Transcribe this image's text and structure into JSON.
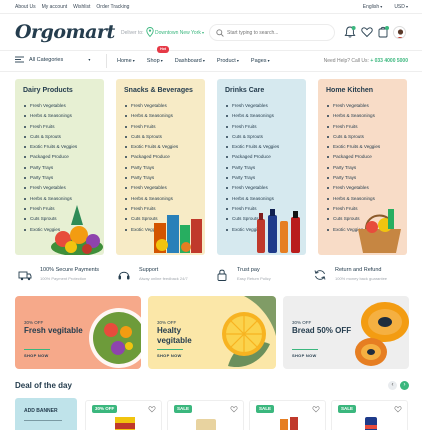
{
  "topbar": {
    "links": [
      "About Us",
      "My account",
      "Wishlist",
      "Order Tracking"
    ],
    "language": "English",
    "currency": "USD"
  },
  "header": {
    "logo": "Orgomart",
    "deliver_label": "Deliver to:",
    "location": "Downtown New York",
    "search_placeholder": "Start typing to search..."
  },
  "nav": {
    "all_categories": "All Categories",
    "menu": [
      "Home",
      "Shop",
      "Dashboard",
      "Product",
      "Pages"
    ],
    "hot_badge": "Hot",
    "help_label": "Need Help? Call Us:",
    "help_phone": "+ 033 4000 5000"
  },
  "categories": [
    {
      "title": "Dairy Products",
      "bg": "#e7f0d3",
      "items": [
        "Fresh Vegetables",
        "Herbs & Seasonings",
        "Fresh Fruits",
        "Cuts & Sprouts",
        "Exotic Fruits & Veggies",
        "Packaged Produce",
        "Party Trays",
        "Party Trays",
        "Fresh Vegetables",
        "Herbs & Seasonings",
        "Fresh Fruits",
        "Cuts Sprouts",
        "Exotic Veggies"
      ]
    },
    {
      "title": "Snacks & Beverages",
      "bg": "#f7ebc6",
      "items": [
        "Fresh Vegetables",
        "Herbs & Seasonings",
        "Fresh Fruits",
        "Cuts & Sprouts",
        "Exotic Fruits & Veggies",
        "Packaged Produce",
        "Party Trays",
        "Party Trays",
        "Fresh Vegetables",
        "Herbs & Seasonings",
        "Fresh Fruits",
        "Cuts Sprouts",
        "Exotic Veggies"
      ]
    },
    {
      "title": "Drinks Care",
      "bg": "#d6e9ef",
      "items": [
        "Fresh Vegetables",
        "Herbs & Seasonings",
        "Fresh Fruits",
        "Cuts & Sprouts",
        "Exotic Fruits & Veggies",
        "Packaged Produce",
        "Party Trays",
        "Party Trays",
        "Fresh Vegetables",
        "Herbs & Seasonings",
        "Fresh Fruits",
        "Cuts Sprouts",
        "Exotic Veggies"
      ]
    },
    {
      "title": "Home Kitchen",
      "bg": "#f8dcc7",
      "items": [
        "Fresh Vegetables",
        "Herbs & Seasonings",
        "Fresh Fruits",
        "Cuts & Sprouts",
        "Exotic Fruits & Veggies",
        "Packaged Produce",
        "Party Trays",
        "Party Trays",
        "Fresh Vegetables",
        "Herbs & Seasonings",
        "Fresh Fruits",
        "Cuts Sprouts",
        "Exotic Veggies"
      ]
    }
  ],
  "features": [
    {
      "title": "100% Secure Payments",
      "sub": "100% Payment Protection",
      "icon": "truck-icon"
    },
    {
      "title": "Support",
      "sub": "Alway online feedback 24/7",
      "icon": "headset-icon"
    },
    {
      "title": "Trust pay",
      "sub": "Easy Return Policy",
      "icon": "lock-icon"
    },
    {
      "title": "Return and Refund",
      "sub": "100% money back guarantee",
      "icon": "refresh-icon"
    }
  ],
  "banners": [
    {
      "off": "30% OFF",
      "title": "Fresh vegitable",
      "shop": "SHOP NOW",
      "bg": "#f6a98a"
    },
    {
      "off": "30% OFF",
      "title": "Healty vegitable",
      "shop": "SHOP NOW",
      "bg": "#fbe7a8"
    },
    {
      "off": "30% OFF",
      "title": "Bread 50% OFF",
      "shop": "SHOP NOW",
      "bg": "#eeeeee"
    }
  ],
  "deal": {
    "title": "Deal of the day",
    "promo": "ADD BANNER",
    "tags": [
      "30% OFF",
      "SALE",
      "SALE",
      "SALE"
    ]
  },
  "colors": {
    "accent": "#3bb77e",
    "hot": "#e63946",
    "text": "#253d4e"
  }
}
